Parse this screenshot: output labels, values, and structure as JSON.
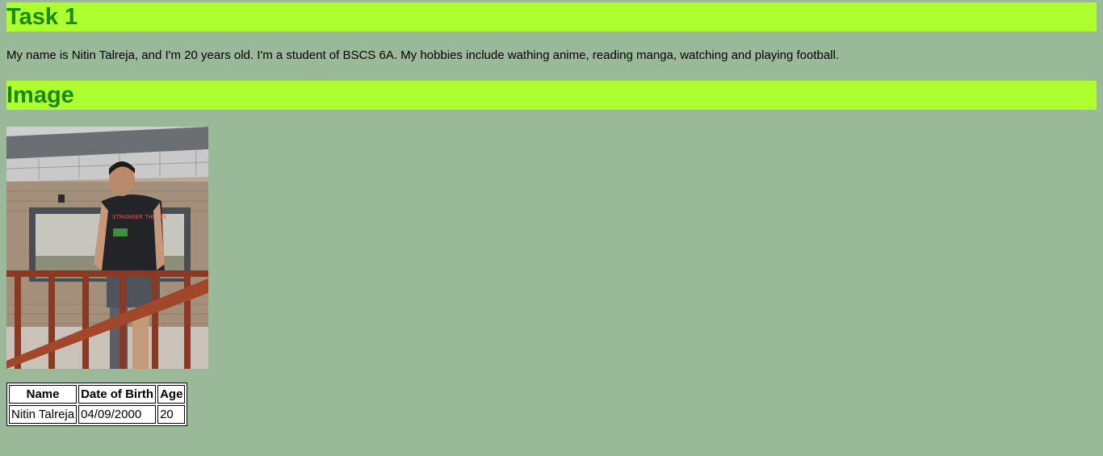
{
  "headings": {
    "task": "Task 1",
    "image": "Image"
  },
  "bio": "My name is Nitin Talreja, and I'm 20 years old. I'm a student of BSCS 6A. My hobbies include wathing anime, reading manga, watching and playing football.",
  "photo": {
    "alt": "Photo of Nitin Talreja standing on a balcony",
    "shirt_text": "STRANGER THINGS"
  },
  "table": {
    "headers": [
      "Name",
      "Date of Birth",
      "Age"
    ],
    "rows": [
      [
        "Nitin Talreja",
        "04/09/2000",
        "20"
      ]
    ]
  },
  "colors": {
    "page_background": "#99b999",
    "heading_background": "#adff2f",
    "heading_text": "#1a8a16"
  }
}
